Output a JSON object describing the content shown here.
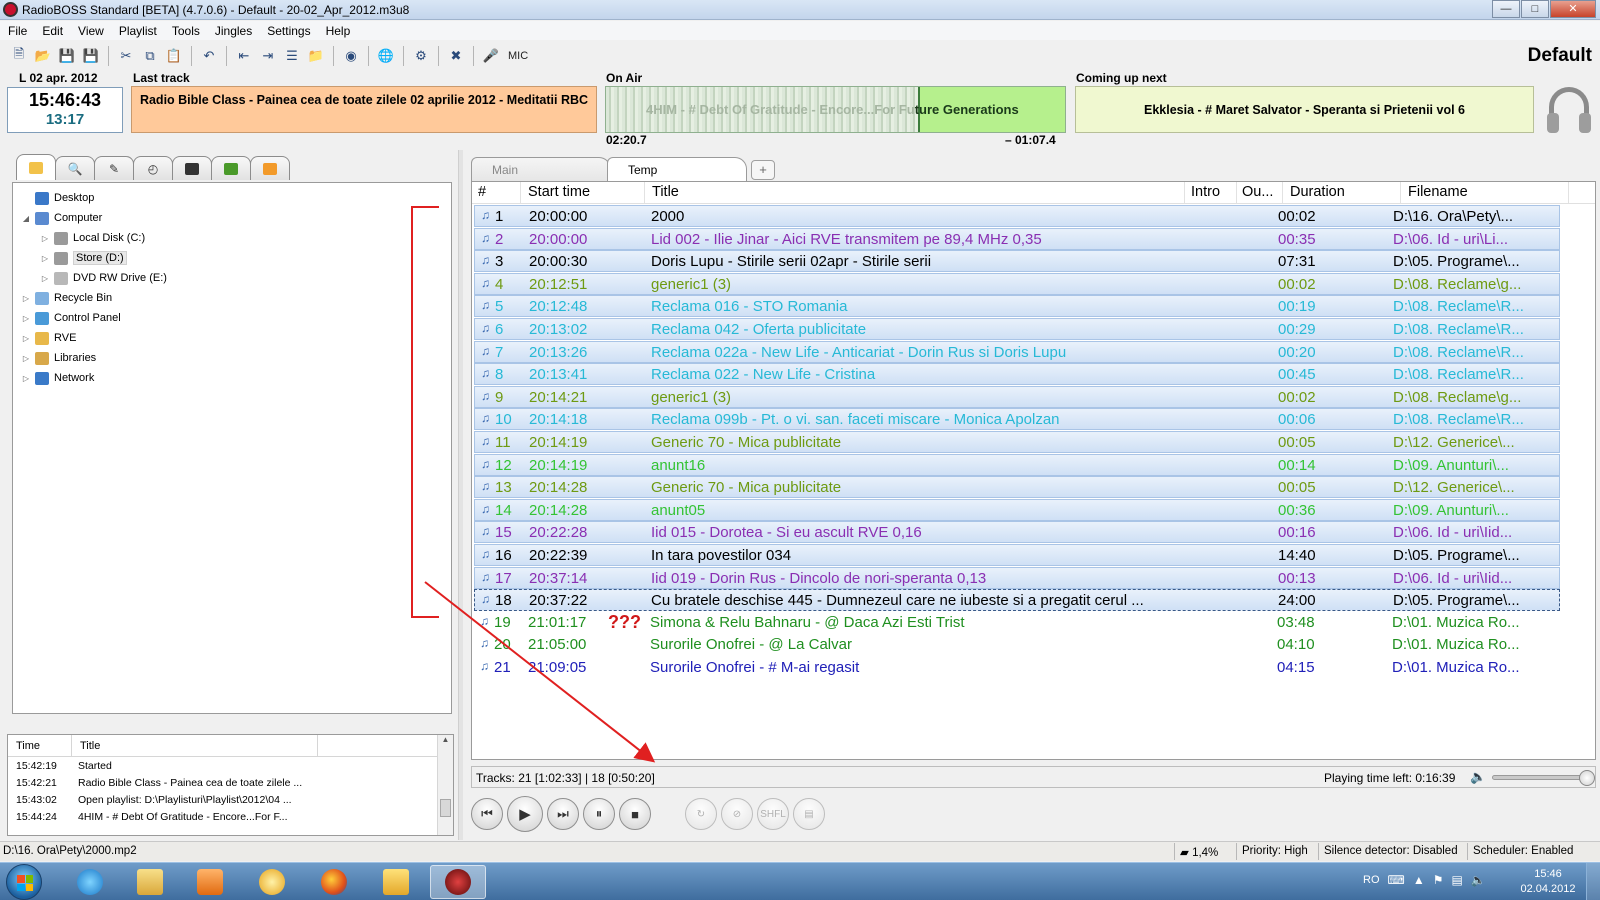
{
  "window": {
    "title": "RadioBOSS Standard [BETA] (4.7.0.6) - Default - 20-02_Apr_2012.m3u8",
    "buttons": [
      "minimize",
      "maximize",
      "close"
    ]
  },
  "menu": [
    "File",
    "Edit",
    "View",
    "Playlist",
    "Tools",
    "Jingles",
    "Settings",
    "Help"
  ],
  "toolbar": {
    "icons": [
      "new-icon",
      "open-icon",
      "save-icon",
      "save-as-icon",
      "cut-icon",
      "copy-icon",
      "paste-icon",
      "undo-icon",
      "insert-icon",
      "insert-after-icon",
      "insert-playlist-icon",
      "insert-folder-icon",
      "cart-icon",
      "globe-icon",
      "scheduler-icon",
      "tools-icon",
      "mic-icon"
    ],
    "mic_label": "MIC",
    "profile": "Default"
  },
  "header": {
    "date": "L 02 apr. 2012",
    "clock_time": "15:46:43",
    "clock_sub": "13:17",
    "last_track_label": "Last track",
    "last_track": "Radio Bible Class -  Painea cea de toate zilele 02 aprilie 2012 - Meditatii RBC",
    "on_air_label": "On Air",
    "on_air_prefix": "4HIM -  # Debt Of Gratitude - Encore...For Fu",
    "on_air_suffix": "ture Generations",
    "on_air_elapsed": "02:20.7",
    "on_air_remaining": "– 01:07.4",
    "on_air_progress": 0.677,
    "coming_up_label": "Coming up next",
    "coming_up": "Ekklesia -  # Maret Salvator - Speranta si Prietenii vol 6"
  },
  "colors": {
    "last_track_bg": "#ffc99a",
    "on_air_bg": "#b6f08d",
    "coming_up_bg": "#f0f8d0",
    "annotation": "#e02020"
  },
  "left_tabs": [
    "folder-icon",
    "search-icon",
    "tag-icon",
    "clock-icon",
    "record-icon",
    "puzzle-icon",
    "gear-icon"
  ],
  "tree": [
    {
      "label": "Desktop",
      "icon": "desktop-icon",
      "level": 0,
      "expander": ""
    },
    {
      "label": "Computer",
      "icon": "computer-icon",
      "level": 0,
      "expander": "◢"
    },
    {
      "label": "Local Disk (C:)",
      "icon": "drive-icon",
      "level": 1,
      "expander": "▷"
    },
    {
      "label": "Store (D:)",
      "icon": "drive-icon",
      "level": 1,
      "expander": "▷",
      "selected": true
    },
    {
      "label": "DVD RW Drive (E:)",
      "icon": "dvd-icon",
      "level": 1,
      "expander": "▷"
    },
    {
      "label": "Recycle Bin",
      "icon": "recycle-bin-icon",
      "level": 0,
      "expander": "▷"
    },
    {
      "label": "Control Panel",
      "icon": "control-panel-icon",
      "level": 0,
      "expander": "▷"
    },
    {
      "label": "RVE",
      "icon": "folder-icon",
      "level": 0,
      "expander": "▷"
    },
    {
      "label": "Libraries",
      "icon": "libraries-icon",
      "level": 0,
      "expander": "▷"
    },
    {
      "label": "Network",
      "icon": "network-icon",
      "level": 0,
      "expander": "▷"
    }
  ],
  "log": {
    "columns": [
      "Time",
      "Title"
    ],
    "rows": [
      {
        "time": "15:42:19",
        "title": "Started"
      },
      {
        "time": "15:42:21",
        "title": "Radio Bible Class -  Painea cea de toate zilele ..."
      },
      {
        "time": "15:43:02",
        "title": "Open playlist: D:\\Playlisturi\\Playlist\\2012\\04 ..."
      },
      {
        "time": "15:44:24",
        "title": "4HIM -  # Debt Of Gratitude - Encore...For F..."
      }
    ]
  },
  "playlist_tabs": [
    "Main",
    "Temp"
  ],
  "playlist_columns": [
    "#",
    "Start time",
    "Title",
    "Intro",
    "Ou...",
    "Duration",
    "Filename"
  ],
  "playlist": [
    {
      "num": "1",
      "start": "20:00:00",
      "title": "2000",
      "duration": "00:02",
      "file": "D:\\16. Ora\\Pety\\...",
      "color": "#000000",
      "bg": true
    },
    {
      "num": "2",
      "start": "20:00:00",
      "title": "Lid 002 - Ilie Jinar - Aici RVE transmitem pe 89,4 MHz       0,35",
      "duration": "00:35",
      "file": "D:\\06. Id - uri\\Li...",
      "color": "#8a2fb2",
      "bg": true
    },
    {
      "num": "3",
      "start": "20:00:30",
      "title": "Doris Lupu -  Stirile serii 02apr - Stirile serii",
      "duration": "07:31",
      "file": "D:\\05. Programe\\...",
      "color": "#000000",
      "bg": true
    },
    {
      "num": "4",
      "start": "20:12:51",
      "title": "generic1 (3)",
      "duration": "00:02",
      "file": "D:\\08. Reclame\\g...",
      "color": "#6e9a12",
      "bg": true
    },
    {
      "num": "5",
      "start": "20:12:48",
      "title": "Reclama 016 -  STO Romania",
      "duration": "00:19",
      "file": "D:\\08. Reclame\\R...",
      "color": "#27b9d6",
      "bg": true
    },
    {
      "num": "6",
      "start": "20:13:02",
      "title": "Reclama 042 - Oferta publicitate",
      "duration": "00:29",
      "file": "D:\\08. Reclame\\R...",
      "color": "#27b9d6",
      "bg": true
    },
    {
      "num": "7",
      "start": "20:13:26",
      "title": "Reclama 022a -  New Life - Anticariat - Dorin Rus si Doris Lupu",
      "duration": "00:20",
      "file": "D:\\08. Reclame\\R...",
      "color": "#27b9d6",
      "bg": true
    },
    {
      "num": "8",
      "start": "20:13:41",
      "title": "Reclama 022 -  New Life - Cristina",
      "duration": "00:45",
      "file": "D:\\08. Reclame\\R...",
      "color": "#27b9d6",
      "bg": true
    },
    {
      "num": "9",
      "start": "20:14:21",
      "title": "generic1 (3)",
      "duration": "00:02",
      "file": "D:\\08. Reclame\\g...",
      "color": "#6e9a12",
      "bg": true
    },
    {
      "num": "10",
      "start": "20:14:18",
      "title": "Reclama 099b -  Pt. o vi. san. faceti miscare - Monica Apolzan",
      "duration": "00:06",
      "file": "D:\\08. Reclame\\R...",
      "color": "#27b9d6",
      "bg": true
    },
    {
      "num": "11",
      "start": "20:14:19",
      "title": "Generic 70 - Mica publicitate",
      "duration": "00:05",
      "file": "D:\\12. Generice\\...",
      "color": "#6e9a12",
      "bg": true
    },
    {
      "num": "12",
      "start": "20:14:19",
      "title": "anunt16",
      "duration": "00:14",
      "file": "D:\\09. Anunturi\\...",
      "color": "#34c334",
      "bg": true
    },
    {
      "num": "13",
      "start": "20:14:28",
      "title": "Generic 70 - Mica publicitate",
      "duration": "00:05",
      "file": "D:\\12. Generice\\...",
      "color": "#6e9a12",
      "bg": true
    },
    {
      "num": "14",
      "start": "20:14:28",
      "title": "anunt05",
      "duration": "00:36",
      "file": "D:\\09. Anunturi\\...",
      "color": "#34c334",
      "bg": true
    },
    {
      "num": "15",
      "start": "20:22:28",
      "title": "Iid 015 - Dorotea - Si eu ascult RVE        0,16",
      "duration": "00:16",
      "file": "D:\\06. Id - uri\\Iid...",
      "color": "#8a2fb2",
      "bg": true
    },
    {
      "num": "16",
      "start": "20:22:39",
      "title": "In tara povestilor 034",
      "duration": "14:40",
      "file": "D:\\05. Programe\\...",
      "color": "#000000",
      "bg": true
    },
    {
      "num": "17",
      "start": "20:37:14",
      "title": "Iid 019 - Dorin Rus - Dincolo de nori-speranta       0,13",
      "duration": "00:13",
      "file": "D:\\06. Id - uri\\Iid...",
      "color": "#8a2fb2",
      "bg": true
    },
    {
      "num": "18",
      "start": "20:37:22",
      "title": "Cu bratele deschise 445 - Dumnezeul care ne iubeste si a pregatit cerul ...",
      "duration": "24:00",
      "file": "D:\\05. Programe\\...",
      "color": "#000000",
      "bg": true,
      "current": true
    },
    {
      "num": "19",
      "start": "21:01:17",
      "title": "Simona & Relu Bahnaru -  @ Daca Azi Esti Trist",
      "duration": "03:48",
      "file": "D:\\01. Muzica Ro...",
      "color": "#1f8f1f",
      "bg": false,
      "flag": "???"
    },
    {
      "num": "20",
      "start": "21:05:00",
      "title": "Surorile Onofrei -  @ La Calvar",
      "duration": "04:10",
      "file": "D:\\01. Muzica Ro...",
      "color": "#1f8f1f",
      "bg": false
    },
    {
      "num": "21",
      "start": "21:09:05",
      "title": "Surorile Onofrei -  # M-ai regasit",
      "duration": "04:15",
      "file": "D:\\01. Muzica Ro...",
      "color": "#2020b8",
      "bg": false
    }
  ],
  "playlist_status": {
    "tracks": "Tracks: 21 [1:02:33]   |  18 [0:50:20]",
    "time_left": "Playing time left: 0:16:39",
    "volume": 1.0
  },
  "transport": {
    "main": [
      {
        "name": "previous-button",
        "glyph": "⏮"
      },
      {
        "name": "play-button",
        "glyph": "▶"
      },
      {
        "name": "next-button",
        "glyph": "⏭"
      },
      {
        "name": "pause-button",
        "glyph": "⏸"
      },
      {
        "name": "stop-button",
        "glyph": "■"
      }
    ],
    "extra": [
      {
        "name": "loop-button",
        "glyph": "↻"
      },
      {
        "name": "stop-after-button",
        "glyph": "⊘"
      },
      {
        "name": "shuffle-button",
        "glyph": "SHFL"
      },
      {
        "name": "library-button",
        "glyph": "▤"
      }
    ]
  },
  "statusbar": {
    "path": "D:\\16. Ora\\Pety\\2000.mp2",
    "cpu": "1,4%",
    "priority": "Priority: High",
    "silence": "Silence detector: Disabled",
    "scheduler": "Scheduler: Enabled"
  },
  "taskbar": {
    "apps": [
      "internet-explorer-icon",
      "explorer-icon",
      "media-player-icon",
      "browser-icon",
      "firefox-icon",
      "checkmark-app-icon",
      "radioboss-icon"
    ],
    "lang": "RO",
    "time": "15:46",
    "date": "02.04.2012"
  }
}
